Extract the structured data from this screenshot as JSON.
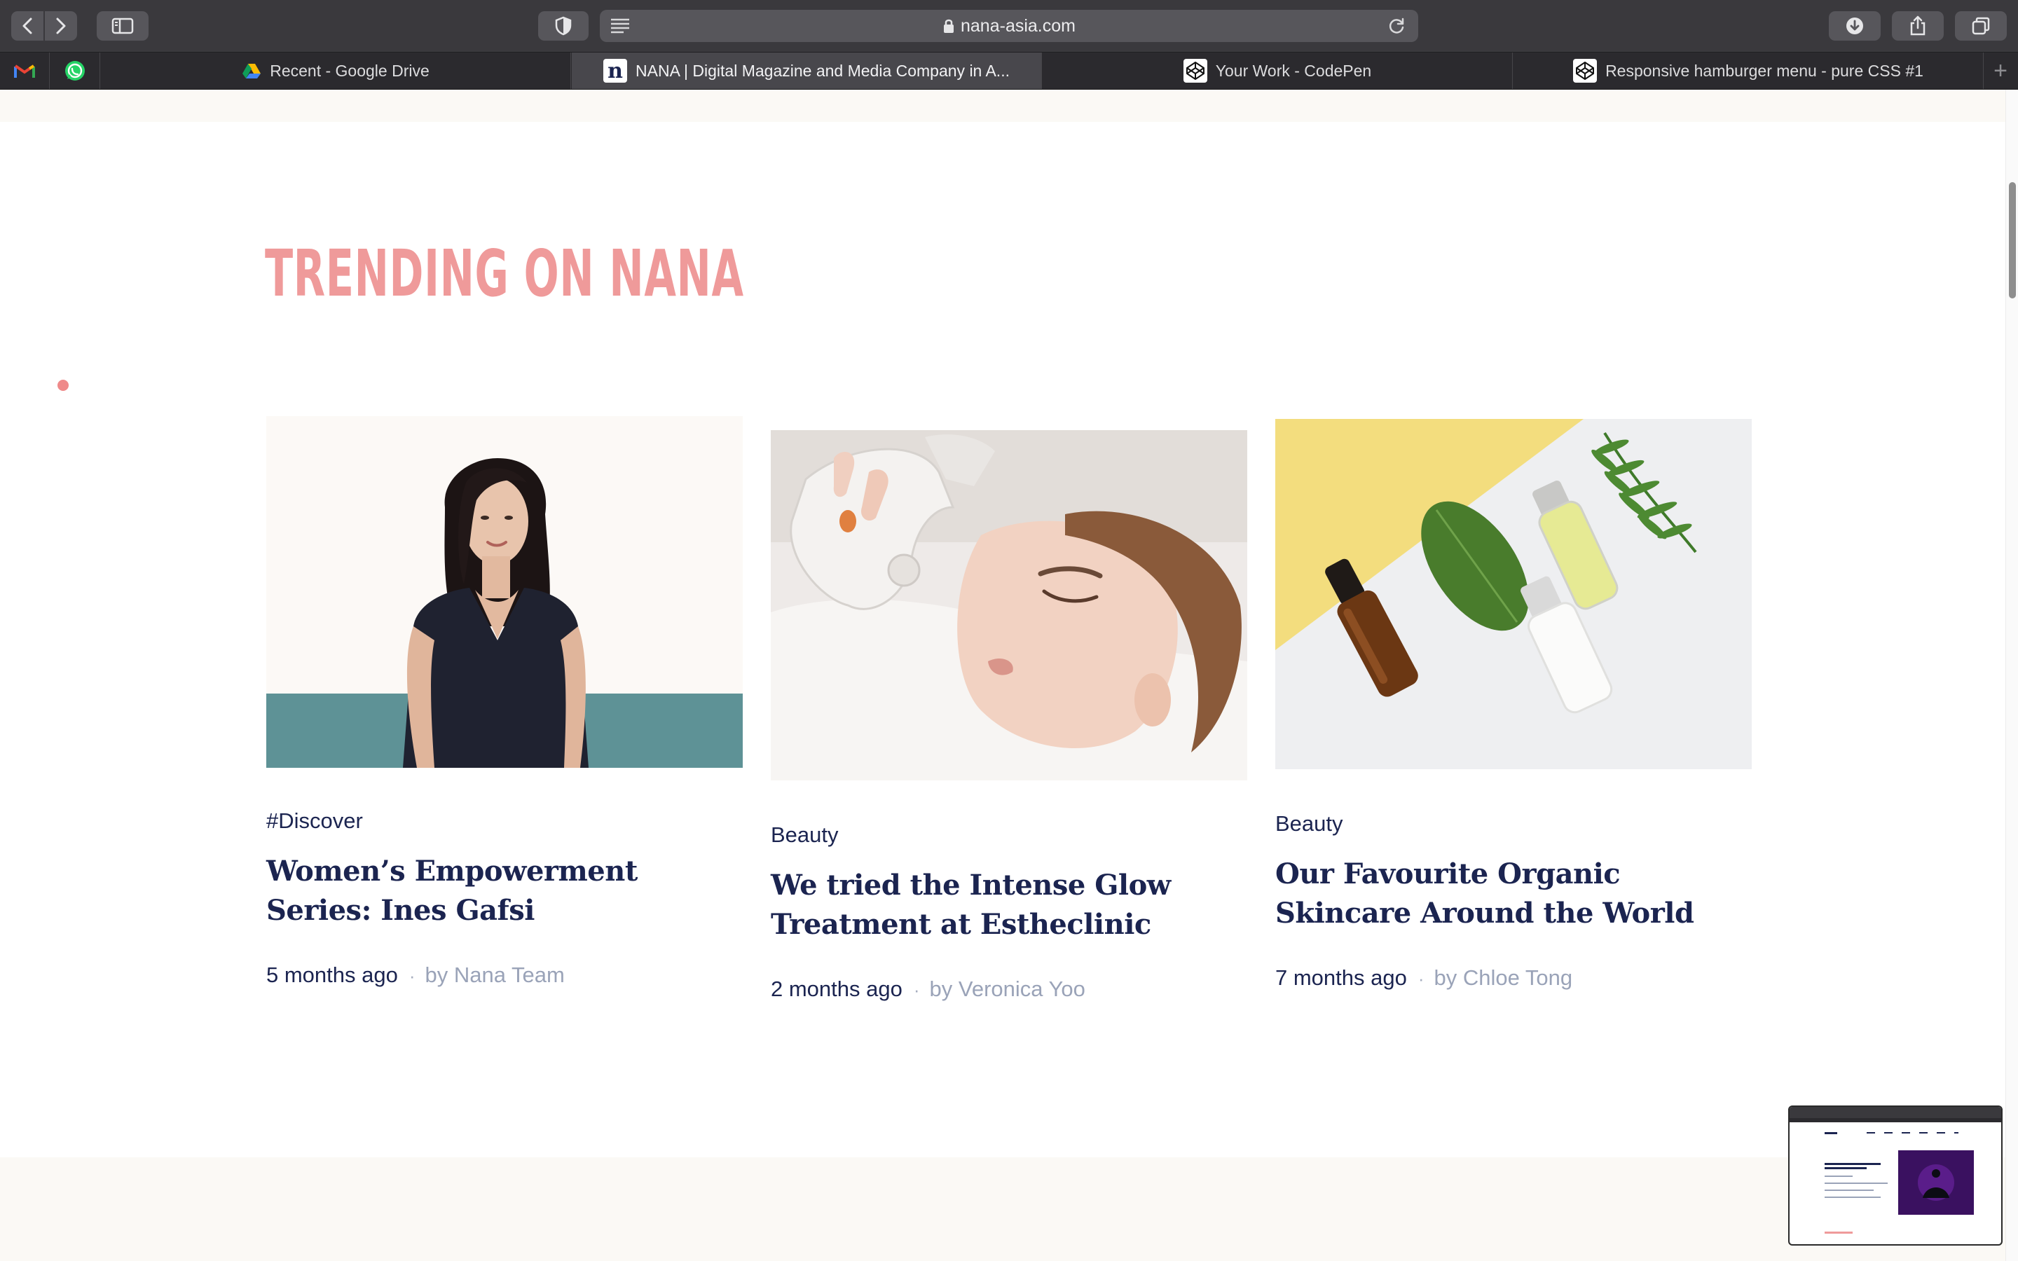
{
  "browser": {
    "url": "nana-asia.com",
    "tabs": [
      {
        "label": "Recent - Google Drive",
        "icon": "google-drive-icon",
        "active": false
      },
      {
        "label": "NANA | Digital Magazine and Media Company in A...",
        "icon": "nana-favicon-icon",
        "active": true
      },
      {
        "label": "Your Work - CodePen",
        "icon": "codepen-icon",
        "active": false
      },
      {
        "label": "Responsive hamburger menu - pure CSS #1",
        "icon": "codepen-icon",
        "active": false
      }
    ],
    "pinned": [
      "gmail-icon",
      "whatsapp-icon"
    ]
  },
  "section": {
    "title": "TRENDING ON NANA",
    "accent": "#ef9a9a",
    "text_color": "#1b2450"
  },
  "articles": [
    {
      "category": "#Discover",
      "title": "Women’s Empowerment Series: Ines Gafsi",
      "time": "5 months ago",
      "author": "by Nana Team",
      "image": "portrait-woman-teal-band"
    },
    {
      "category": "Beauty",
      "title": "We tried the Intense Glow Treatment at Estheclinic",
      "time": "2 months ago",
      "author": "by Veronica Yoo",
      "image": "facial-treatment-photo"
    },
    {
      "category": "Beauty",
      "title": "Our Favourite Organic Skincare Around the World",
      "time": "7 months ago",
      "author": "by Chloe Tong",
      "image": "organic-skincare-bottles-photo"
    }
  ]
}
